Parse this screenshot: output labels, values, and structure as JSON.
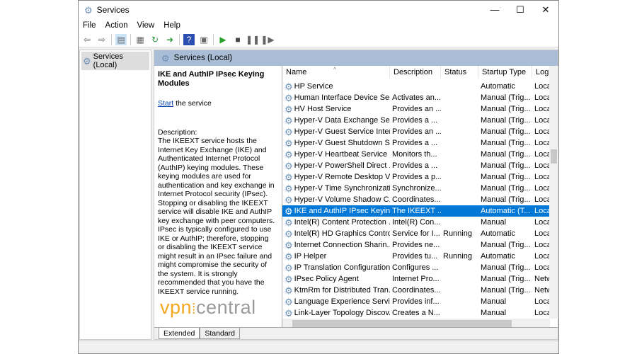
{
  "window": {
    "title": "Services",
    "minimize": "—",
    "maximize": "☐",
    "close": "✕"
  },
  "menu": [
    "File",
    "Action",
    "View",
    "Help"
  ],
  "toolbar": [
    "back-icon",
    "forward-icon",
    "show-hide-tree-icon",
    "properties-icon",
    "refresh-icon",
    "export-icon",
    "help-icon",
    "console-icon",
    "start-icon",
    "stop-icon",
    "pause-icon",
    "restart-icon"
  ],
  "tree": {
    "item": "Services (Local)"
  },
  "band": {
    "title": "Services (Local)"
  },
  "details": {
    "title": "IKE and AuthIP IPsec Keying Modules",
    "start_link": "Start",
    "start_rest": " the service",
    "desc_label": "Description:",
    "desc": "The IKEEXT service hosts the Internet Key Exchange (IKE) and Authenticated Internet Protocol (AuthIP) keying modules. These keying modules are used for authentication and key exchange in Internet Protocol security (IPsec). Stopping or disabling the IKEEXT service will disable IKE and AuthIP key exchange with peer computers. IPsec is typically configured to use IKE or AuthIP; therefore, stopping or disabling the IKEEXT service might result in an IPsec failure and might compromise the security of the system. It is strongly recommended that you have the IKEEXT service running."
  },
  "logo": {
    "text_a": "vpn",
    "text_b": "central"
  },
  "columns": [
    "Name",
    "Description",
    "Status",
    "Startup Type",
    "Log"
  ],
  "rows": [
    [
      "HP Service",
      "",
      "",
      "Automatic",
      "Loca"
    ],
    [
      "Human Interface Device Ser...",
      "Activates an...",
      "",
      "Manual (Trig...",
      "Loca"
    ],
    [
      "HV Host Service",
      "Provides an ...",
      "",
      "Manual (Trig...",
      "Loca"
    ],
    [
      "Hyper-V Data Exchange Ser...",
      "Provides a ...",
      "",
      "Manual (Trig...",
      "Loca"
    ],
    [
      "Hyper-V Guest Service Inter...",
      "Provides an ...",
      "",
      "Manual (Trig...",
      "Loca"
    ],
    [
      "Hyper-V Guest Shutdown S...",
      "Provides a ...",
      "",
      "Manual (Trig...",
      "Loca"
    ],
    [
      "Hyper-V Heartbeat Service",
      "Monitors th...",
      "",
      "Manual (Trig...",
      "Loca"
    ],
    [
      "Hyper-V PowerShell Direct ...",
      "Provides a ...",
      "",
      "Manual (Trig...",
      "Loca"
    ],
    [
      "Hyper-V Remote Desktop Vi...",
      "Provides a p...",
      "",
      "Manual (Trig...",
      "Loca"
    ],
    [
      "Hyper-V Time Synchronizati...",
      "Synchronize...",
      "",
      "Manual (Trig...",
      "Loca"
    ],
    [
      "Hyper-V Volume Shadow C...",
      "Coordinates...",
      "",
      "Manual (Trig...",
      "Loca"
    ],
    [
      "IKE and AuthIP IPsec Keying...",
      "The IKEEXT ...",
      "",
      "Automatic (T...",
      "Loca"
    ],
    [
      "Intel(R) Content Protection ...",
      "Intel(R) Con...",
      "",
      "Manual",
      "Loca"
    ],
    [
      "Intel(R) HD Graphics Contro...",
      "Service for I...",
      "Running",
      "Automatic",
      "Loca"
    ],
    [
      "Internet Connection Sharin...",
      "Provides ne...",
      "",
      "Manual (Trig...",
      "Loca"
    ],
    [
      "IP Helper",
      "Provides tu...",
      "Running",
      "Automatic",
      "Loca"
    ],
    [
      "IP Translation Configuration...",
      "Configures ...",
      "",
      "Manual (Trig...",
      "Loca"
    ],
    [
      "IPsec Policy Agent",
      "Internet Pro...",
      "",
      "Manual (Trig...",
      "Netw"
    ],
    [
      "KtmRm for Distributed Tran...",
      "Coordinates...",
      "",
      "Manual (Trig...",
      "Netw"
    ],
    [
      "Language Experience Service",
      "Provides inf...",
      "",
      "Manual",
      "Loca"
    ],
    [
      "Link-Layer Topology Discov...",
      "Creates a N...",
      "",
      "Manual",
      "Loca"
    ]
  ],
  "selected_row": 11,
  "tabs": [
    "Extended",
    "Standard"
  ],
  "colors": {
    "selection": "#0078d7",
    "band": "#a9bed6"
  }
}
